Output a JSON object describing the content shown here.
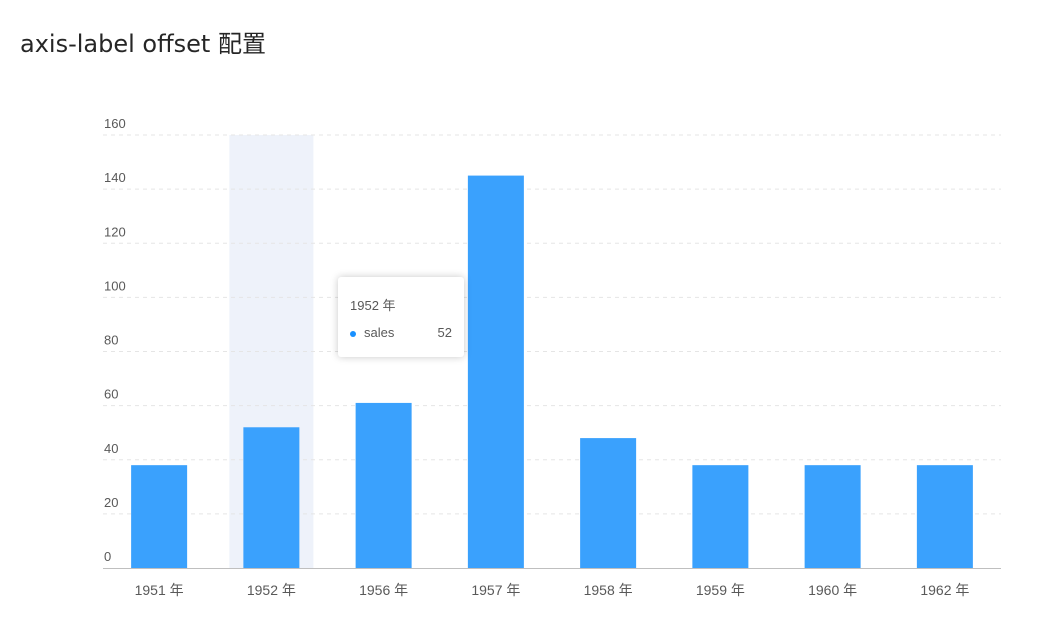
{
  "page": {
    "title": "axis-label offset 配置"
  },
  "colors": {
    "bar": "#3aa1fd",
    "highlight": "#eef2fa",
    "grid": "#e5e5e5",
    "axis_line": "#bfbfbf",
    "label": "#595959"
  },
  "tooltip": {
    "title": "1952 年",
    "series_name": "sales",
    "value": "52",
    "marker_color": "#1890ff"
  },
  "chart_data": {
    "type": "bar",
    "categories": [
      "1951 年",
      "1952 年",
      "1956 年",
      "1957 年",
      "1958 年",
      "1959 年",
      "1960 年",
      "1962 年"
    ],
    "series": [
      {
        "name": "sales",
        "values": [
          38,
          52,
          61,
          145,
          48,
          38,
          38,
          38
        ]
      }
    ],
    "title": "",
    "xlabel": "",
    "ylabel": "",
    "ylim": [
      0,
      160
    ],
    "yticks": [
      0,
      20,
      40,
      60,
      80,
      100,
      120,
      140,
      160
    ],
    "grid": true,
    "highlighted_category": "1952 年",
    "legend": "none"
  }
}
